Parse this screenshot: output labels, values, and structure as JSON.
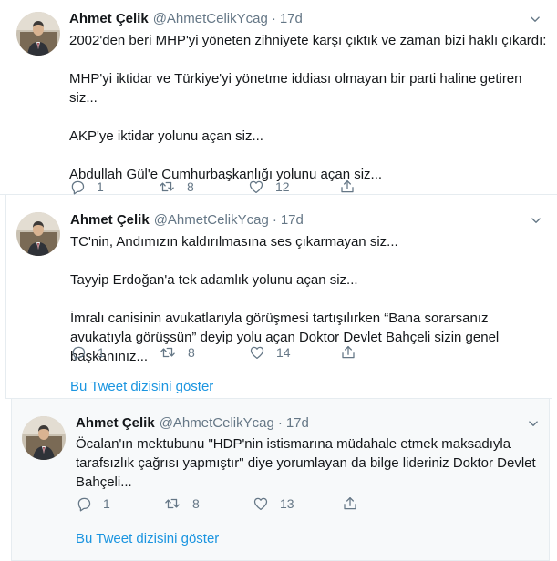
{
  "tweets": [
    {
      "author_name": "Ahmet Çelik",
      "handle": "@AhmetCelikYcag",
      "separator": "·",
      "time": "17d",
      "paragraphs": [
        "2002'den beri MHP'yi yöneten zihniyete karşı çıktık ve zaman bizi haklı çıkardı:",
        "MHP'yi iktidar ve Türkiye'yi yönetme iddiası olmayan bir parti haline getiren siz...",
        "AKP'ye iktidar yolunu açan siz...",
        "Abdullah Gül'e Cumhurbaşkanlığı yolunu açan siz..."
      ],
      "replies": "1",
      "retweets": "8",
      "likes": "12"
    },
    {
      "author_name": "Ahmet Çelik",
      "handle": "@AhmetCelikYcag",
      "separator": "·",
      "time": "17d",
      "paragraphs": [
        "TC'nin, Andımızın kaldırılmasına ses çıkarmayan siz...",
        "Tayyip Erdoğan'a tek adamlık yolunu açan siz...",
        "İmralı canisinin avukatlarıyla görüşmesi tartışılırken “Bana sorarsanız avukatıyla görüşsün” deyip yolu açan Doktor Devlet Bahçeli sizin genel başkanınız..."
      ],
      "replies": "1",
      "retweets": "8",
      "likes": "14",
      "thread_link": "Bu Tweet dizisini göster"
    },
    {
      "author_name": "Ahmet Çelik",
      "handle": "@AhmetCelikYcag",
      "separator": "·",
      "time": "17d",
      "paragraphs": [
        "Öcalan'ın mektubunu \"HDP'nin istismarına müdahale etmek maksadıyla tarafsızlık çağrısı yapmıştır\" diye yorumlayan da bilge lideriniz Doktor Devlet Bahçeli..."
      ],
      "replies": "1",
      "retweets": "8",
      "likes": "13",
      "thread_link": "Bu Tweet dizisini göster"
    }
  ],
  "icons": {
    "reply": "reply-icon",
    "retweet": "retweet-icon",
    "like": "heart-icon",
    "share": "share-icon",
    "more": "chevron-down-icon"
  },
  "colors": {
    "text": "#14171a",
    "secondary": "#657786",
    "link": "#1b95e0",
    "divider": "#e6ecf0"
  }
}
